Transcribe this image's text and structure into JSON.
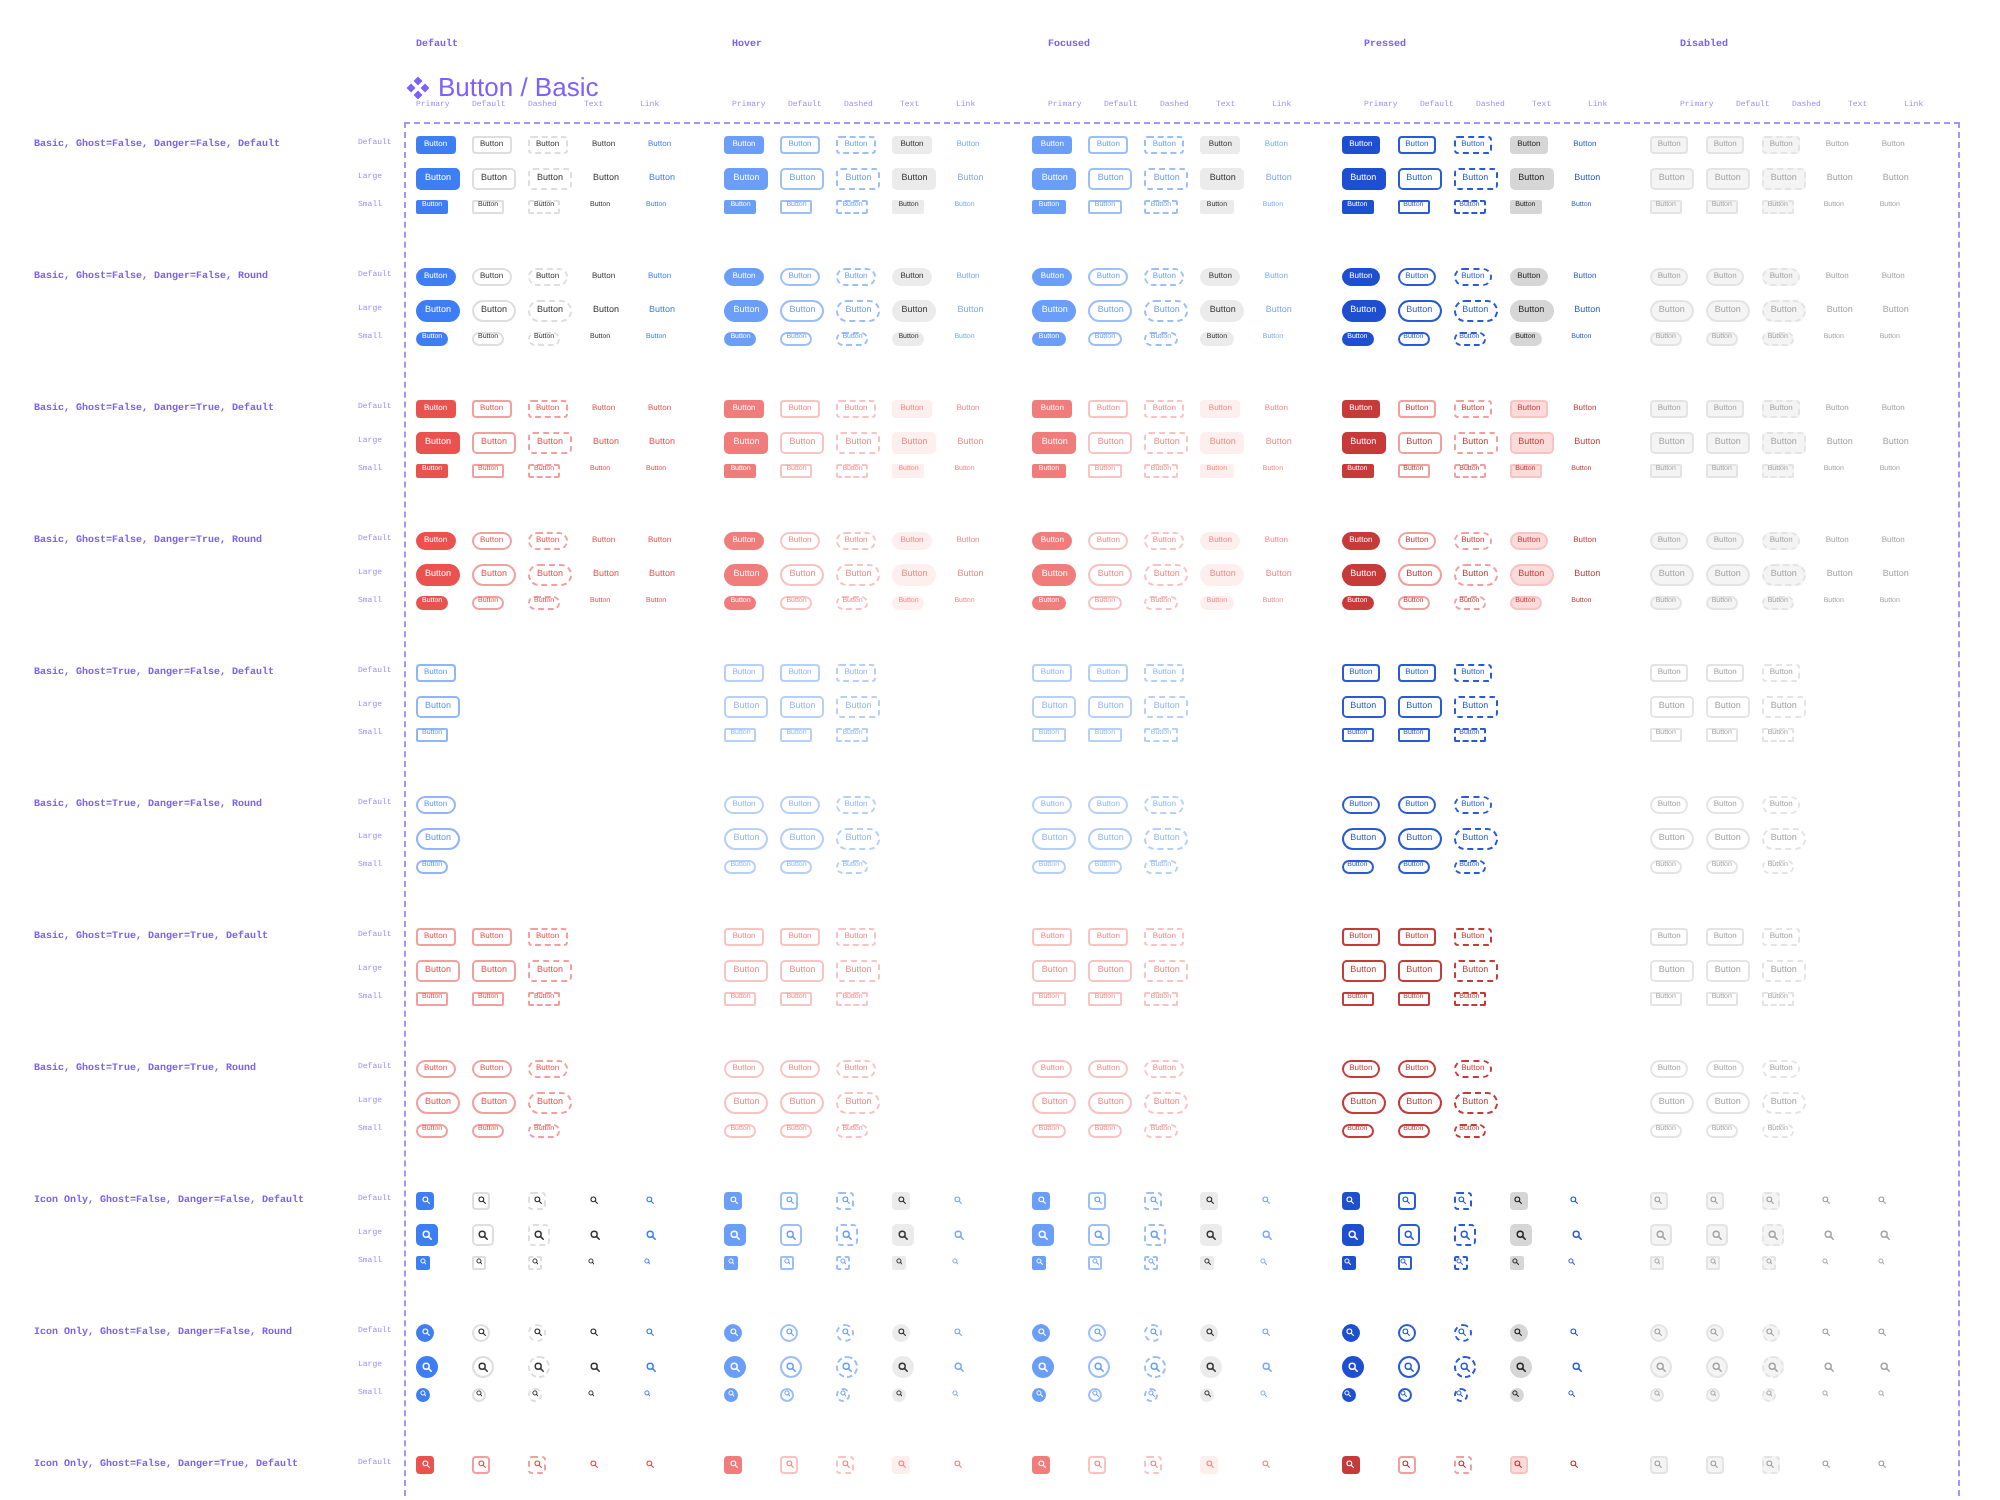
{
  "title": "Button / Basic",
  "states": [
    {
      "label": "Default",
      "kind": "default",
      "columns": [
        {
          "label": "Primary",
          "kind": "primary"
        },
        {
          "label": "Default",
          "kind": "default"
        },
        {
          "label": "Dashed",
          "kind": "dashed"
        },
        {
          "label": "Text",
          "kind": "text"
        },
        {
          "label": "Link",
          "kind": "link"
        }
      ]
    },
    {
      "label": "Hover",
      "kind": "hover",
      "columns": [
        {
          "label": "Primary",
          "kind": "primary"
        },
        {
          "label": "Default",
          "kind": "default"
        },
        {
          "label": "Dashed",
          "kind": "dashed"
        },
        {
          "label": "Text",
          "kind": "text"
        },
        {
          "label": "Link",
          "kind": "link"
        }
      ]
    },
    {
      "label": "Focused",
      "kind": "focused",
      "columns": [
        {
          "label": "Primary",
          "kind": "primary"
        },
        {
          "label": "Default",
          "kind": "default"
        },
        {
          "label": "Dashed",
          "kind": "dashed"
        },
        {
          "label": "Text",
          "kind": "text"
        },
        {
          "label": "Link",
          "kind": "link"
        }
      ]
    },
    {
      "label": "Pressed",
      "kind": "pressed",
      "columns": [
        {
          "label": "Primary",
          "kind": "primary"
        },
        {
          "label": "Default",
          "kind": "default"
        },
        {
          "label": "Dashed",
          "kind": "dashed"
        },
        {
          "label": "Text",
          "kind": "text"
        },
        {
          "label": "Link",
          "kind": "link"
        }
      ]
    },
    {
      "label": "Disabled",
      "kind": "disabled",
      "columns": [
        {
          "label": "Primary",
          "kind": "primary"
        },
        {
          "label": "Default",
          "kind": "default"
        },
        {
          "label": "Dashed",
          "kind": "dashed"
        },
        {
          "label": "Text",
          "kind": "text"
        },
        {
          "label": "Link",
          "kind": "link"
        }
      ]
    }
  ],
  "groups": [
    {
      "label": "Basic, Ghost=False, Danger=False, Default",
      "kind": "basic",
      "ghost": false,
      "danger": false,
      "round": false,
      "rows": [
        {
          "label": "Default",
          "kind": "middle",
          "cells": [
            [
              "Button",
              "Button",
              "Button",
              "Button",
              "Button"
            ],
            [
              "Button",
              "Button",
              "Button",
              "Button",
              "Button"
            ],
            [
              "Button",
              "Button",
              "Button",
              "Button",
              "Button"
            ],
            [
              "Button",
              "Button",
              "Button",
              "Button",
              "Button"
            ],
            [
              "Button",
              "Button",
              "Button",
              "Button",
              "Button"
            ]
          ]
        },
        {
          "label": "Large",
          "kind": "large",
          "cells": [
            [
              "Button",
              "Button",
              "Button",
              "Button",
              "Button"
            ],
            [
              "Button",
              "Button",
              "Button",
              "Button",
              "Button"
            ],
            [
              "Button",
              "Button",
              "Button",
              "Button",
              "Button"
            ],
            [
              "Button",
              "Button",
              "Button",
              "Button",
              "Button"
            ],
            [
              "Button",
              "Button",
              "Button",
              "Button",
              "Button"
            ]
          ]
        },
        {
          "label": "Small",
          "kind": "small",
          "cells": [
            [
              "Button",
              "Button",
              "Button",
              "Button",
              "Button"
            ],
            [
              "Button",
              "Button",
              "Button",
              "Button",
              "Button"
            ],
            [
              "Button",
              "Button",
              "Button",
              "Button",
              "Button"
            ],
            [
              "Button",
              "Button",
              "Button",
              "Button",
              "Button"
            ],
            [
              "Button",
              "Button",
              "Button",
              "Button",
              "Button"
            ]
          ]
        }
      ]
    },
    {
      "label": "Basic, Ghost=False, Danger=False, Round",
      "kind": "basic",
      "ghost": false,
      "danger": false,
      "round": true,
      "rows": [
        {
          "label": "Default",
          "kind": "middle",
          "cells": [
            [
              "Button",
              "Button",
              "Button",
              "Button",
              "Button"
            ],
            [
              "Button",
              "Button",
              "Button",
              "Button",
              "Button"
            ],
            [
              "Button",
              "Button",
              "Button",
              "Button",
              "Button"
            ],
            [
              "Button",
              "Button",
              "Button",
              "Button",
              "Button"
            ],
            [
              "Button",
              "Button",
              "Button",
              "Button",
              "Button"
            ]
          ]
        },
        {
          "label": "Large",
          "kind": "large",
          "cells": [
            [
              "Button",
              "Button",
              "Button",
              "Button",
              "Button"
            ],
            [
              "Button",
              "Button",
              "Button",
              "Button",
              "Button"
            ],
            [
              "Button",
              "Button",
              "Button",
              "Button",
              "Button"
            ],
            [
              "Button",
              "Button",
              "Button",
              "Button",
              "Button"
            ],
            [
              "Button",
              "Button",
              "Button",
              "Button",
              "Button"
            ]
          ]
        },
        {
          "label": "Small",
          "kind": "small",
          "cells": [
            [
              "Button",
              "Button",
              "Button",
              "Button",
              "Button"
            ],
            [
              "Button",
              "Button",
              "Button",
              "Button",
              "Button"
            ],
            [
              "Button",
              "Button",
              "Button",
              "Button",
              "Button"
            ],
            [
              "Button",
              "Button",
              "Button",
              "Button",
              "Button"
            ],
            [
              "Button",
              "Button",
              "Button",
              "Button",
              "Button"
            ]
          ]
        }
      ]
    },
    {
      "label": "Basic, Ghost=False, Danger=True, Default",
      "kind": "basic",
      "ghost": false,
      "danger": true,
      "round": false,
      "rows": [
        {
          "label": "Default",
          "kind": "middle",
          "cells": [
            [
              "Button",
              "Button",
              "Button",
              "Button",
              "Button"
            ],
            [
              "Button",
              "Button",
              "Button",
              "Button",
              "Button"
            ],
            [
              "Button",
              "Button",
              "Button",
              "Button",
              "Button"
            ],
            [
              "Button",
              "Button",
              "Button",
              "Button",
              "Button"
            ],
            [
              "Button",
              "Button",
              "Button",
              "Button",
              "Button"
            ]
          ]
        },
        {
          "label": "Large",
          "kind": "large",
          "cells": [
            [
              "Button",
              "Button",
              "Button",
              "Button",
              "Button"
            ],
            [
              "Button",
              "Button",
              "Button",
              "Button",
              "Button"
            ],
            [
              "Button",
              "Button",
              "Button",
              "Button",
              "Button"
            ],
            [
              "Button",
              "Button",
              "Button",
              "Button",
              "Button"
            ],
            [
              "Button",
              "Button",
              "Button",
              "Button",
              "Button"
            ]
          ]
        },
        {
          "label": "Small",
          "kind": "small",
          "cells": [
            [
              "Button",
              "Button",
              "Button",
              "Button",
              "Button"
            ],
            [
              "Button",
              "Button",
              "Button",
              "Button",
              "Button"
            ],
            [
              "Button",
              "Button",
              "Button",
              "Button",
              "Button"
            ],
            [
              "Button",
              "Button",
              "Button",
              "Button",
              "Button"
            ],
            [
              "Button",
              "Button",
              "Button",
              "Button",
              "Button"
            ]
          ]
        }
      ]
    },
    {
      "label": "Basic, Ghost=False, Danger=True, Round",
      "kind": "basic",
      "ghost": false,
      "danger": true,
      "round": true,
      "rows": [
        {
          "label": "Default",
          "kind": "middle",
          "cells": [
            [
              "Button",
              "Button",
              "Button",
              "Button",
              "Button"
            ],
            [
              "Button",
              "Button",
              "Button",
              "Button",
              "Button"
            ],
            [
              "Button",
              "Button",
              "Button",
              "Button",
              "Button"
            ],
            [
              "Button",
              "Button",
              "Button",
              "Button",
              "Button"
            ],
            [
              "Button",
              "Button",
              "Button",
              "Button",
              "Button"
            ]
          ]
        },
        {
          "label": "Large",
          "kind": "large",
          "cells": [
            [
              "Button",
              "Button",
              "Button",
              "Button",
              "Button"
            ],
            [
              "Button",
              "Button",
              "Button",
              "Button",
              "Button"
            ],
            [
              "Button",
              "Button",
              "Button",
              "Button",
              "Button"
            ],
            [
              "Button",
              "Button",
              "Button",
              "Button",
              "Button"
            ],
            [
              "Button",
              "Button",
              "Button",
              "Button",
              "Button"
            ]
          ]
        },
        {
          "label": "Small",
          "kind": "small",
          "cells": [
            [
              "Button",
              "Button",
              "Button",
              "Button",
              "Button"
            ],
            [
              "Button",
              "Button",
              "Button",
              "Button",
              "Button"
            ],
            [
              "Button",
              "Button",
              "Button",
              "Button",
              "Button"
            ],
            [
              "Button",
              "Button",
              "Button",
              "Button",
              "Button"
            ],
            [
              "Button",
              "Button",
              "Button",
              "Button",
              "Button"
            ]
          ]
        }
      ]
    },
    {
      "label": "Basic, Ghost=True, Danger=False, Default",
      "kind": "basic",
      "ghost": true,
      "danger": false,
      "round": false,
      "rows": [
        {
          "label": "Default",
          "kind": "middle",
          "cells": [
            [
              "Button"
            ],
            [
              "Button",
              "Button",
              "Button"
            ],
            [
              "Button",
              "Button",
              "Button"
            ],
            [
              "Button",
              "Button",
              "Button"
            ],
            [
              "Button",
              "Button",
              "Button"
            ]
          ]
        },
        {
          "label": "Large",
          "kind": "large",
          "cells": [
            [
              "Button"
            ],
            [
              "Button",
              "Button",
              "Button"
            ],
            [
              "Button",
              "Button",
              "Button"
            ],
            [
              "Button",
              "Button",
              "Button"
            ],
            [
              "Button",
              "Button",
              "Button"
            ]
          ]
        },
        {
          "label": "Small",
          "kind": "small",
          "cells": [
            [
              "Button"
            ],
            [
              "Button",
              "Button",
              "Button"
            ],
            [
              "Button",
              "Button",
              "Button"
            ],
            [
              "Button",
              "Button",
              "Button"
            ],
            [
              "Button",
              "Button",
              "Button"
            ]
          ]
        }
      ]
    },
    {
      "label": "Basic, Ghost=True, Danger=False, Round",
      "kind": "basic",
      "ghost": true,
      "danger": false,
      "round": true,
      "rows": [
        {
          "label": "Default",
          "kind": "middle",
          "cells": [
            [
              "Button"
            ],
            [
              "Button",
              "Button",
              "Button"
            ],
            [
              "Button",
              "Button",
              "Button"
            ],
            [
              "Button",
              "Button",
              "Button"
            ],
            [
              "Button",
              "Button",
              "Button"
            ]
          ]
        },
        {
          "label": "Large",
          "kind": "large",
          "cells": [
            [
              "Button"
            ],
            [
              "Button",
              "Button",
              "Button"
            ],
            [
              "Button",
              "Button",
              "Button"
            ],
            [
              "Button",
              "Button",
              "Button"
            ],
            [
              "Button",
              "Button",
              "Button"
            ]
          ]
        },
        {
          "label": "Small",
          "kind": "small",
          "cells": [
            [
              "Button"
            ],
            [
              "Button",
              "Button",
              "Button"
            ],
            [
              "Button",
              "Button",
              "Button"
            ],
            [
              "Button",
              "Button",
              "Button"
            ],
            [
              "Button",
              "Button",
              "Button"
            ]
          ]
        }
      ]
    },
    {
      "label": "Basic, Ghost=True, Danger=True, Default",
      "kind": "basic",
      "ghost": true,
      "danger": true,
      "round": false,
      "rows": [
        {
          "label": "Default",
          "kind": "middle",
          "cells": [
            [
              "Button",
              "Button",
              "Button"
            ],
            [
              "Button",
              "Button",
              "Button"
            ],
            [
              "Button",
              "Button",
              "Button"
            ],
            [
              "Button",
              "Button",
              "Button"
            ],
            [
              "Button",
              "Button",
              "Button"
            ]
          ]
        },
        {
          "label": "Large",
          "kind": "large",
          "cells": [
            [
              "Button",
              "Button",
              "Button"
            ],
            [
              "Button",
              "Button",
              "Button"
            ],
            [
              "Button",
              "Button",
              "Button"
            ],
            [
              "Button",
              "Button",
              "Button"
            ],
            [
              "Button",
              "Button",
              "Button"
            ]
          ]
        },
        {
          "label": "Small",
          "kind": "small",
          "cells": [
            [
              "Button",
              "Button",
              "Button"
            ],
            [
              "Button",
              "Button",
              "Button"
            ],
            [
              "Button",
              "Button",
              "Button"
            ],
            [
              "Button",
              "Button",
              "Button"
            ],
            [
              "Button",
              "Button",
              "Button"
            ]
          ]
        }
      ]
    },
    {
      "label": "Basic, Ghost=True, Danger=True, Round",
      "kind": "basic",
      "ghost": true,
      "danger": true,
      "round": true,
      "rows": [
        {
          "label": "Default",
          "kind": "middle",
          "cells": [
            [
              "Button",
              "Button",
              "Button"
            ],
            [
              "Button",
              "Button",
              "Button"
            ],
            [
              "Button",
              "Button",
              "Button"
            ],
            [
              "Button",
              "Button",
              "Button"
            ],
            [
              "Button",
              "Button",
              "Button"
            ]
          ]
        },
        {
          "label": "Large",
          "kind": "large",
          "cells": [
            [
              "Button",
              "Button",
              "Button"
            ],
            [
              "Button",
              "Button",
              "Button"
            ],
            [
              "Button",
              "Button",
              "Button"
            ],
            [
              "Button",
              "Button",
              "Button"
            ],
            [
              "Button",
              "Button",
              "Button"
            ]
          ]
        },
        {
          "label": "Small",
          "kind": "small",
          "cells": [
            [
              "Button",
              "Button",
              "Button"
            ],
            [
              "Button",
              "Button",
              "Button"
            ],
            [
              "Button",
              "Button",
              "Button"
            ],
            [
              "Button",
              "Button",
              "Button"
            ],
            [
              "Button",
              "Button",
              "Button"
            ]
          ]
        }
      ]
    },
    {
      "label": "Icon Only, Ghost=False, Danger=False, Default",
      "kind": "icon_only",
      "ghost": false,
      "danger": false,
      "round": false,
      "rows": [
        {
          "label": "Default",
          "kind": "middle"
        },
        {
          "label": "Large",
          "kind": "large"
        },
        {
          "label": "Small",
          "kind": "small"
        }
      ]
    },
    {
      "label": "Icon Only, Ghost=False, Danger=False, Round",
      "kind": "icon_only",
      "ghost": false,
      "danger": false,
      "round": true,
      "rows": [
        {
          "label": "Default",
          "kind": "middle"
        },
        {
          "label": "Large",
          "kind": "large"
        },
        {
          "label": "Small",
          "kind": "small"
        }
      ]
    },
    {
      "label": "Icon Only, Ghost=False, Danger=True, Default",
      "kind": "icon_only",
      "ghost": false,
      "danger": true,
      "round": false,
      "rows": [
        {
          "label": "Default",
          "kind": "middle"
        }
      ]
    }
  ]
}
